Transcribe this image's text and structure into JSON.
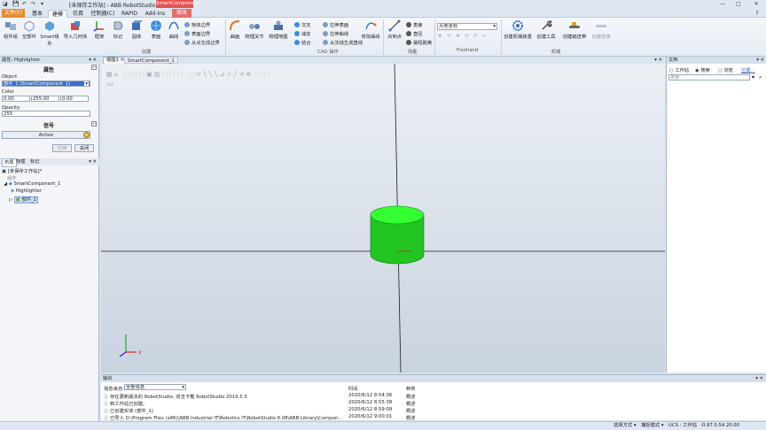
{
  "titlebar": {
    "app_title": "[未保存工作站] - ABB RobotStudio 6.08",
    "context_badge": "SmartComponent",
    "minimize": "—",
    "maximize": "□",
    "close": "✕"
  },
  "tabs": {
    "file": "文件(F)",
    "items": [
      "基本",
      "建模",
      "仿真",
      "控制器(C)",
      "RAPID",
      "Add-Ins"
    ],
    "active_index": 1,
    "context": "修改"
  },
  "ribbon": {
    "create": {
      "buttons": [
        "组件组",
        "空部件",
        "Smart组件",
        "导入几何体",
        "框架",
        "标记",
        "固体",
        "表面",
        "曲线"
      ],
      "side": [
        "物体边界",
        "表面边界",
        "从点生成边界"
      ],
      "label": "创建"
    },
    "cad": {
      "buttons": [
        "曲面",
        "物理关节",
        "物理地图"
      ],
      "side": [
        "交叉",
        "拉伸表面",
        "减去",
        "拉伸曲线",
        "结合",
        "从法线生成直线"
      ],
      "modify_curve": "修改曲线",
      "label": "CAD 操作"
    },
    "measure": {
      "point_to_point": "点到点",
      "side": [
        "角度",
        "直径",
        "最短距离"
      ],
      "label": "测量"
    },
    "freehand": {
      "coord_select": "大地坐标",
      "label": "Freehand"
    },
    "mechanism": {
      "buttons": [
        "创建机械装置",
        "创建工具",
        "创建输送带",
        "创建连接"
      ],
      "label": "机械"
    }
  },
  "left": {
    "header": "属性: Highlighter",
    "properties_title": "属性",
    "object_label": "Object",
    "object_value": "部件_1 (SmartComponent_1)",
    "color_label": "Color",
    "color_values": [
      "0.00",
      "255.00",
      "0.00"
    ],
    "opacity_label": "Opacity",
    "opacity_value": "255",
    "signals_title": "信号",
    "active_label": "Active",
    "apply_button": "应用",
    "close_button": "关闭",
    "tree_tabs": [
      "布局",
      "物理",
      "标记"
    ],
    "tree": {
      "station": "[未保存工作站]*",
      "components_group": "组件",
      "smart_component": "SmartComponent_1",
      "highlighter": "Highlighter",
      "part": "部件_1"
    }
  },
  "viewport": {
    "tabs": [
      "视图1",
      "SmartComponent_1"
    ],
    "axis_labels": [
      "x",
      "y",
      "z"
    ],
    "cylinder_color": "#22dd22"
  },
  "docs": {
    "title": "文档",
    "options": [
      "工作站",
      "搜索",
      "浏览"
    ],
    "selected_option": "搜索",
    "location_link": "位置...",
    "search_placeholder": "搜索"
  },
  "output": {
    "title": "输出",
    "filter_label": "信息来自:",
    "filter_value": "全部信息",
    "col_time": "时间",
    "col_category": "种类",
    "rows": [
      {
        "text": "存在更新版本的 RobotStudio. 双击下载 RobotStudio 2019.5.3",
        "time": "2020/6/12 8:54:36",
        "cat": "概述"
      },
      {
        "text": "新工作站已创建。",
        "time": "2020/6/12 8:55:38",
        "cat": "概述"
      },
      {
        "text": "已创建实体 (部件_1)",
        "time": "2020/6/12 8:59:09",
        "cat": "概述"
      },
      {
        "text": "已导入 D:\\Program Files (x86)\\ABB Industrial IT\\Robotics IT\\RobotStudio 6.08\\ABB Library\\Compon...",
        "time": "2020/6/12 9:00:01",
        "cat": "概述"
      }
    ]
  },
  "status": {
    "select_mode": "选择方式 ▾",
    "capture_mode": "捕捉模式 ▾",
    "ucs": "UCS : 工作站",
    "coords": "-0.97  0.54  20.00"
  },
  "colors": {
    "file_tab": "#e88b2e",
    "context_tab": "#e56d6a",
    "cylinder": "#22dd22"
  }
}
